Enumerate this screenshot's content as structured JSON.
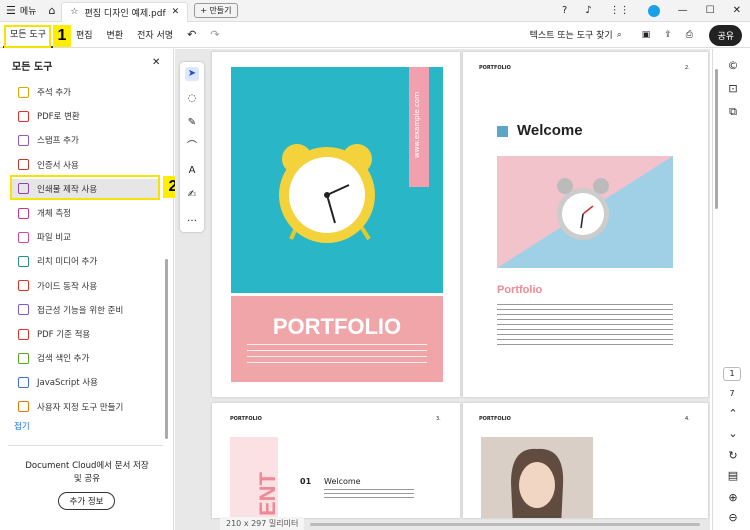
{
  "titlebar": {
    "menu_label": "메뉴",
    "tab_title": "편집 디자인 예제.pdf",
    "new_label": "만들기"
  },
  "toolbar": {
    "all_tools": "모든 도구",
    "edit": "편집",
    "convert": "변환",
    "esign": "전자 서명",
    "search_placeholder": "텍스트 또는 도구 찾기",
    "share": "공유"
  },
  "callouts": {
    "one": "1",
    "two": "2"
  },
  "panel": {
    "title": "모든 도구",
    "items": [
      {
        "label": "주석 추가",
        "color": "#e2a400"
      },
      {
        "label": "PDF로 변환",
        "color": "#d9342b"
      },
      {
        "label": "스탬프 추가",
        "color": "#9b59b6"
      },
      {
        "label": "인증서 사용",
        "color": "#c0392b"
      },
      {
        "label": "인쇄물 제작 사용",
        "color": "#8e44ad"
      },
      {
        "label": "개체 측정",
        "color": "#c2378c"
      },
      {
        "label": "파일 비교",
        "color": "#d14b9b"
      },
      {
        "label": "리치 미디어 추가",
        "color": "#2b8a8a"
      },
      {
        "label": "가이드 동작 사용",
        "color": "#d9342b"
      },
      {
        "label": "접근성 기능을 위한 준비",
        "color": "#7d5cc6"
      },
      {
        "label": "PDF 기준 적용",
        "color": "#d9342b"
      },
      {
        "label": "검색 색인 추가",
        "color": "#5aa02c"
      },
      {
        "label": "JavaScript 사용",
        "color": "#3b6fd4"
      },
      {
        "label": "사용자 지정 도구 만들기",
        "color": "#e07b00"
      }
    ],
    "collapse": "접기",
    "cloud_text_1": "Document Cloud에서 문서 저장",
    "cloud_text_2": "및 공유",
    "more_info": "추가 정보"
  },
  "doc": {
    "p1": {
      "url": "www.example.com",
      "portfolio": "PORTFOLIO"
    },
    "p2": {
      "header": "PORTFOLIO",
      "num": "2.",
      "welcome": "Welcome",
      "portfolio": "Portfolio"
    },
    "p3": {
      "header": "PORTFOLIO",
      "num": "3.",
      "num01": "01",
      "welcome": "Welcome",
      "vert": "ENT"
    },
    "p4": {
      "header": "PORTFOLIO",
      "num": "4."
    },
    "page_size": "210 x 297 밀리미터"
  },
  "rail": {
    "page_current": "1",
    "page_total": "7"
  }
}
